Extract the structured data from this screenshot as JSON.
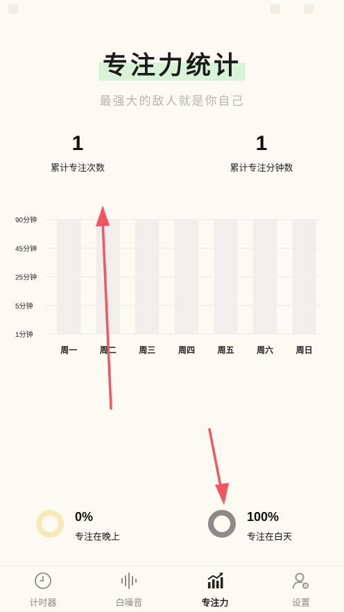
{
  "header": {
    "title": "专注力统计",
    "subtitle": "最强大的敌人就是你自己"
  },
  "stats": [
    {
      "value": "1",
      "label": "累计专注次数"
    },
    {
      "value": "1",
      "label": "累计专注分钟数"
    }
  ],
  "chart_data": {
    "type": "bar",
    "categories": [
      "周一",
      "周二",
      "周三",
      "周四",
      "周五",
      "周六",
      "周日"
    ],
    "y_ticks": [
      "90分钟",
      "45分钟",
      "25分钟",
      "5分钟",
      "1分钟"
    ],
    "series": [
      {
        "values": [
          0,
          0,
          0,
          0,
          0,
          0,
          0
        ]
      }
    ],
    "grid": true,
    "bar_color": "#f1efeb"
  },
  "legend": [
    {
      "percent": "0%",
      "label": "专注在晚上",
      "ring_color": "#f8e9ba"
    },
    {
      "percent": "100%",
      "label": "专注在白天",
      "ring_color": "#8d8b87"
    }
  ],
  "nav": {
    "items": [
      {
        "label": "计时器",
        "icon": "clock-icon",
        "active": false
      },
      {
        "label": "白噪音",
        "icon": "sound-wave-icon",
        "active": false
      },
      {
        "label": "专注力",
        "icon": "chart-icon",
        "active": true
      },
      {
        "label": "设置",
        "icon": "user-gear-icon",
        "active": false
      }
    ]
  },
  "annotations": {
    "arrow_color": "#f25660"
  }
}
